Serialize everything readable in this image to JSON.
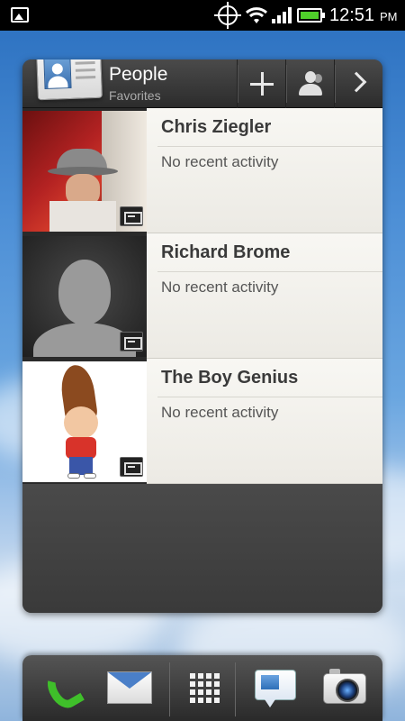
{
  "status_bar": {
    "time": "12:51",
    "ampm": "PM",
    "icons": [
      "gallery-icon",
      "gps-icon",
      "wifi-icon",
      "signal-icon",
      "battery-icon"
    ]
  },
  "widget": {
    "title": "People",
    "subtitle": "Favorites",
    "buttons": [
      "add-contact-icon",
      "contacts-icon",
      "chevron-right-icon"
    ],
    "contacts": [
      {
        "name": "Chris Ziegler",
        "status": "No recent activity"
      },
      {
        "name": "Richard Brome",
        "status": "No recent activity"
      },
      {
        "name": "The Boy Genius",
        "status": "No recent activity"
      }
    ]
  },
  "dock": {
    "items": [
      "phone-icon",
      "mail-icon",
      "all-apps-icon",
      "messages-icon",
      "camera-icon"
    ]
  },
  "colors": {
    "battery": "#4fcf2a",
    "phone": "#3fbf2a"
  }
}
